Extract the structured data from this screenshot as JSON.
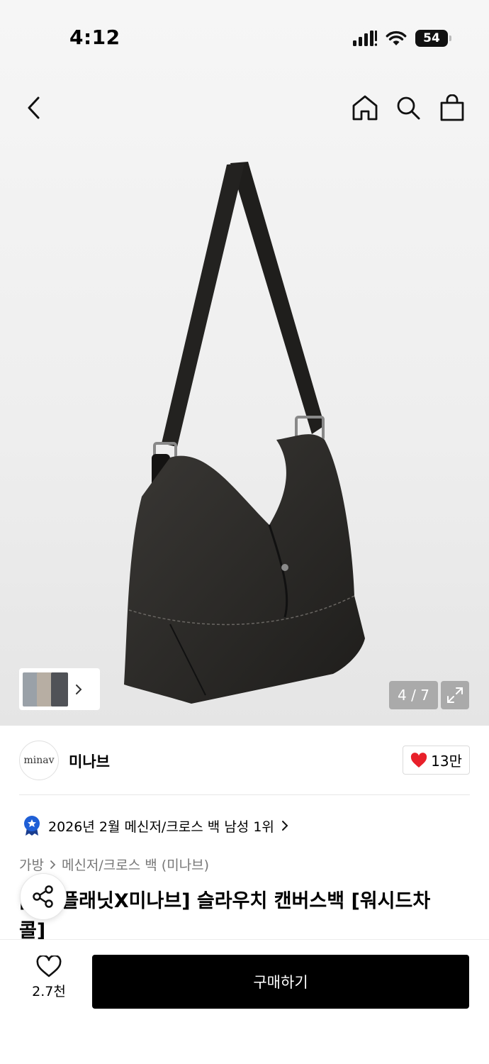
{
  "status_bar": {
    "time": "4:12",
    "battery": "54"
  },
  "header": {
    "back_icon": "chevron-left-icon",
    "home_icon": "home-icon",
    "search_icon": "search-icon",
    "cart_icon": "shopping-bag-icon"
  },
  "gallery": {
    "page_current": 4,
    "page_total": 7,
    "page_label": "4 / 7",
    "product_image": "black-canvas-slouch-bag"
  },
  "brand": {
    "logo_text": "minav",
    "name": "미나브",
    "likes": "13만"
  },
  "ranking": {
    "text": "2026년 2월 메신저/크로스 백 남성 1위"
  },
  "breadcrumb": {
    "category": "가방",
    "subcategory": "메신저/크로스 백 (미나브)"
  },
  "product": {
    "title_line1": "[     플래닛X미나브] 슬라우치 캔버스백 [워시드차",
    "title_line2": "콜]"
  },
  "bottom_bar": {
    "wish_count": "2.7천",
    "buy_label": "구매하기"
  },
  "colors": {
    "accent": "#000000",
    "like_heart": "#e8202a",
    "badge_blue": "#1f5fd6"
  }
}
